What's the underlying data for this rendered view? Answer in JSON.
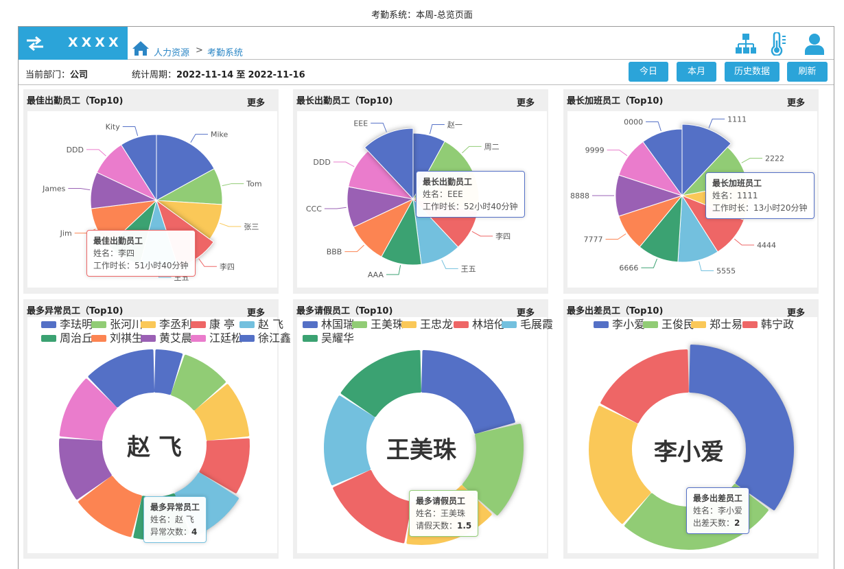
{
  "page_caption": "考勤系统：本周-总览页面",
  "header": {
    "brand": "XXXX",
    "breadcrumb": [
      "人力资源",
      "考勤系统"
    ],
    "breadcrumb_sep": ">"
  },
  "statbar": {
    "dept_label": "当前部门：",
    "dept_value": "公司",
    "period_label": "统计周期：",
    "period_start": "2022-11-14",
    "period_to": "至",
    "period_end": "2022-11-16",
    "buttons": [
      "今日",
      "本月",
      "历史数据",
      "刷新"
    ]
  },
  "more_label": "更多",
  "colors": {
    "brand": "#2ba4d9",
    "palette": [
      "#5470c6",
      "#91cc75",
      "#fac858",
      "#ee6666",
      "#73c0de",
      "#3ba272",
      "#fc8452",
      "#9a60b4",
      "#ea7ccc",
      "#5470c6"
    ]
  },
  "panels": [
    {
      "id": "p1",
      "title": "最佳出勤员工（Top10)",
      "chart_data": {
        "type": "pie",
        "labels": [
          "Mike",
          "Tom",
          "张三",
          "李四",
          "王五",
          "…",
          "Jim",
          "James",
          "DDD",
          "Kity"
        ],
        "values": [
          17,
          9,
          9,
          10,
          9,
          9,
          10,
          9,
          9,
          9
        ],
        "highlight_index": 3
      },
      "tooltip": {
        "title": "最佳出勤员工",
        "line1_label": "姓名：",
        "line1_value": "李四",
        "line2_label": "工作时长：",
        "line2_value": "51小时40分钟"
      }
    },
    {
      "id": "p2",
      "title": "最长出勤员工（Top10)",
      "chart_data": {
        "type": "pie",
        "labels": [
          "赵一",
          "周二",
          "…",
          "李四",
          "王五",
          "AAA",
          "BBB",
          "CCC",
          "DDD",
          "EEE"
        ],
        "values": [
          8,
          10,
          10,
          10,
          10,
          10,
          10,
          10,
          10,
          12
        ],
        "highlight_index": 9
      },
      "tooltip": {
        "title": "最长出勤员工",
        "line1_label": "姓名：",
        "line1_value": "EEE",
        "line2_label": "工作时长：",
        "line2_value": "52小时40分钟"
      }
    },
    {
      "id": "p3",
      "title": "最长加班员工（Top10)",
      "chart_data": {
        "type": "pie",
        "labels": [
          "1111",
          "2222",
          "…",
          "4444",
          "5555",
          "6666",
          "7777",
          "8888",
          "9999",
          "0000"
        ],
        "values": [
          12,
          10,
          9,
          10,
          10,
          10,
          9,
          10,
          10,
          10
        ],
        "highlight_index": 0
      },
      "tooltip": {
        "title": "最长加班员工",
        "line1_label": "姓名：",
        "line1_value": "1111",
        "line2_label": "工作时长：",
        "line2_value": "13小时20分钟"
      }
    },
    {
      "id": "p4",
      "title": "最多异常员工（Top10)",
      "chart_data": {
        "type": "pie",
        "donut": true,
        "labels": [
          "李珐明",
          "张河川",
          "李丞利",
          "康 亭",
          "赵 飞",
          "周治丘",
          "刘祺生",
          "黄艾晨",
          "江廷松",
          "徐江鑫"
        ],
        "values": [
          4,
          7,
          8,
          8,
          8,
          8,
          9,
          9,
          9,
          10
        ],
        "highlight_index": 4
      },
      "center_label": "赵 飞",
      "tooltip": {
        "title": "最多异常员工",
        "line1_label": "姓名：",
        "line1_value": "赵 飞",
        "line2_label": "异常次数：",
        "line2_value": "4"
      }
    },
    {
      "id": "p5",
      "title": "最多请假员工（Top10)",
      "chart_data": {
        "type": "pie",
        "donut": true,
        "labels": [
          "林国瑞",
          "王美珠",
          "王忠龙",
          "林培伦",
          "毛展霞",
          "吴耀华"
        ],
        "values": [
          2,
          1.5,
          1.5,
          1.5,
          1.5,
          1.5
        ],
        "highlight_index": 1
      },
      "center_label": "王美珠",
      "tooltip": {
        "title": "最多请假员工",
        "line1_label": "姓名：",
        "line1_value": "王美珠",
        "line2_label": "请假天数：",
        "line2_value": "1.5"
      }
    },
    {
      "id": "p6",
      "title": "最多出差员工（Top10)",
      "chart_data": {
        "type": "pie",
        "donut": true,
        "labels": [
          "李小爱",
          "王俊民",
          "郑士易",
          "韩宁政"
        ],
        "values": [
          2,
          1.5,
          1.2,
          1
        ],
        "highlight_index": 0
      },
      "center_label": "李小爱",
      "tooltip": {
        "title": "最多出差员工",
        "line1_label": "姓名：",
        "line1_value": "李小爱",
        "line2_label": "出差天数：",
        "line2_value": "2"
      }
    }
  ]
}
